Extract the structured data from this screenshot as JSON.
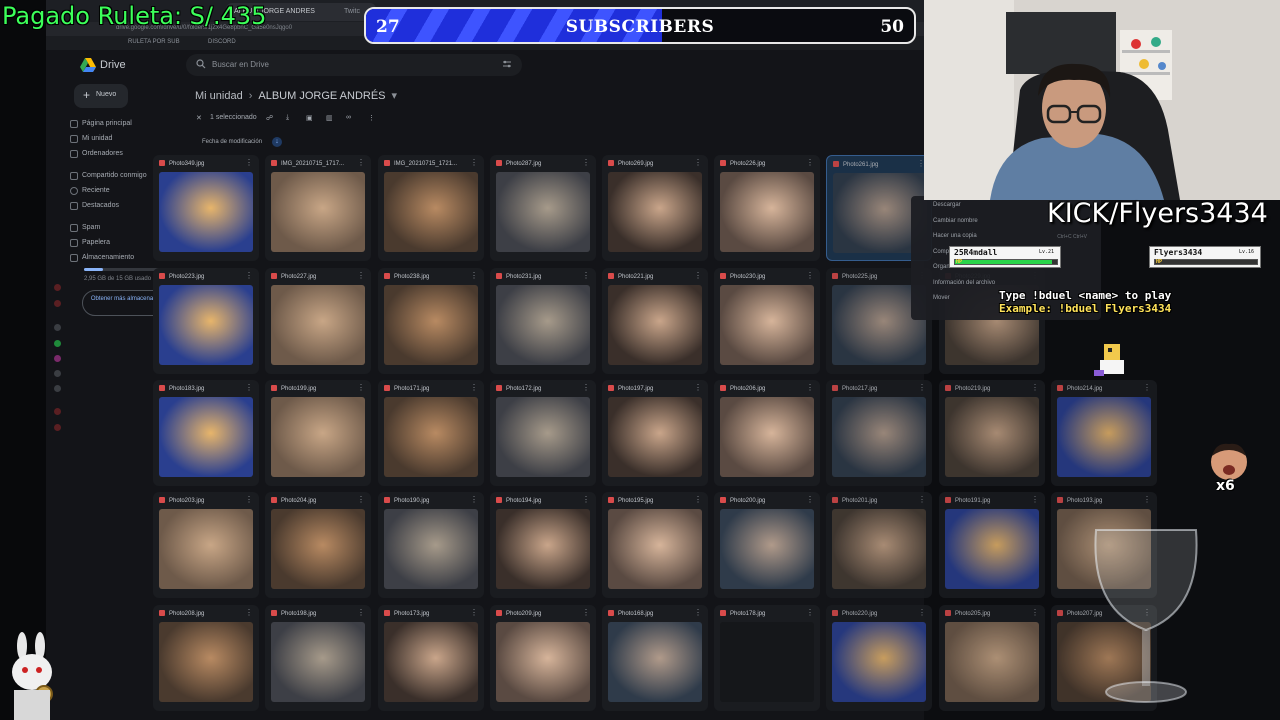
{
  "overlay": {
    "paid_text": "Pagado Ruleta: S/.435",
    "subscribers": {
      "current": "27",
      "label": "SUBSCRIBERS",
      "goal": "50",
      "progress": 0.54
    },
    "kick_text": "KICK/Flyers3434",
    "duel": {
      "player1": {
        "name": "25R4mdall",
        "level": "Lv.21",
        "hp_label": "HP",
        "hp": 0.95
      },
      "player2": {
        "name": "Flyers3434",
        "level": "Lv.16",
        "hp_label": "HP",
        "hp": 0.0
      },
      "line1": "Type !bduel <name> to play",
      "line2": "Example: !bduel Flyers3434"
    },
    "multiplier": "x6"
  },
  "browser": {
    "tabs": [
      {
        "label": "ALBUM JORGE ANDRES",
        "active": true
      },
      {
        "label": "Twitc",
        "active": false
      }
    ],
    "url": "drive.google.com/drive/u/0/folders/1jZx4Ge8pbnC_Ga5e0nsJqgo0",
    "bookmarks": [
      "RULETA POR SUB",
      "DISCORD"
    ]
  },
  "drive": {
    "app_name": "Drive",
    "search_placeholder": "Buscar en Drive",
    "new_label": "Nuevo",
    "nav": [
      {
        "label": "Página principal"
      },
      {
        "label": "Mi unidad"
      },
      {
        "label": "Ordenadores"
      },
      {
        "label": "Compartido conmigo"
      },
      {
        "label": "Reciente"
      },
      {
        "label": "Destacados"
      },
      {
        "label": "Spam"
      },
      {
        "label": "Papelera"
      },
      {
        "label": "Almacenamiento"
      }
    ],
    "storage_text": "2,95 GB de 15 GB usado",
    "storage_fraction": 0.2,
    "more_storage": "Obtener más almacenamiento",
    "breadcrumb": {
      "root": "Mi unidad",
      "current": "ALBUM JORGE ANDRÉS"
    },
    "selection": "1 seleccionado",
    "sort_label": "Fecha de modificación",
    "files": [
      "Photo349.jpg",
      "IMG_20210715_1717...",
      "IMG_20210715_1721...",
      "Photo287.jpg",
      "Photo269.jpg",
      "Photo226.jpg",
      "Photo261.jpg",
      "",
      "Photo223.jpg",
      "Photo227.jpg",
      "Photo238.jpg",
      "Photo231.jpg",
      "Photo221.jpg",
      "Photo230.jpg",
      "Photo225.jpg",
      "Photo229.jpg",
      "Photo183.jpg",
      "Photo199.jpg",
      "Photo171.jpg",
      "Photo172.jpg",
      "Photo197.jpg",
      "Photo206.jpg",
      "Photo217.jpg",
      "Photo219.jpg",
      "Photo214.jpg",
      "Photo203.jpg",
      "Photo204.jpg",
      "Photo190.jpg",
      "Photo194.jpg",
      "Photo195.jpg",
      "Photo200.jpg",
      "Photo201.jpg",
      "Photo191.jpg",
      "Photo193.jpg",
      "Photo208.jpg",
      "Photo198.jpg",
      "Photo173.jpg",
      "Photo209.jpg",
      "Photo168.jpg",
      "Photo178.jpg",
      "Photo220.jpg",
      "Photo205.jpg",
      "Photo207.jpg"
    ],
    "context_menu": [
      {
        "label": "Descargar",
        "shortcut": ""
      },
      {
        "label": "Cambiar nombre",
        "shortcut": ""
      },
      {
        "label": "Hacer una copia",
        "shortcut": "Ctrl+C Ctrl+V"
      },
      {
        "label": "Compartir",
        "shortcut": ""
      },
      {
        "label": "Organizar",
        "shortcut": ""
      },
      {
        "label": "Información del archivo",
        "shortcut": ""
      },
      {
        "label": "Mover",
        "shortcut": ""
      }
    ]
  }
}
